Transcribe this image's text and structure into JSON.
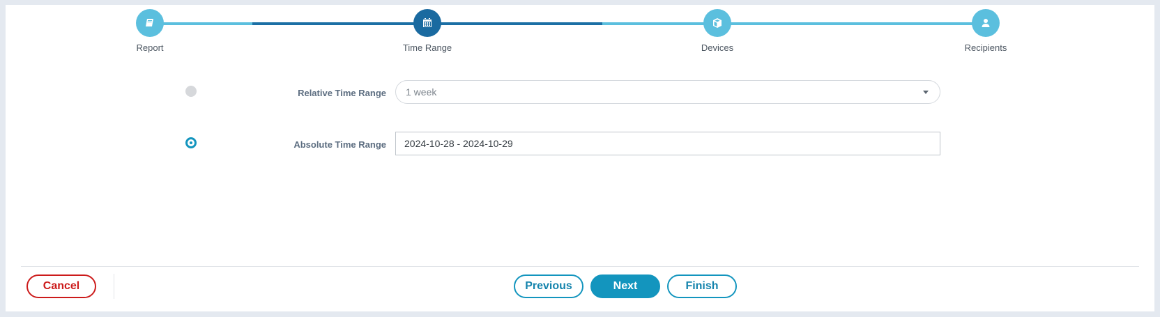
{
  "stepper": {
    "steps": [
      {
        "label": "Report",
        "icon": "book-icon"
      },
      {
        "label": "Time Range",
        "icon": "calendar-icon"
      },
      {
        "label": "Devices",
        "icon": "cube-icon"
      },
      {
        "label": "Recipients",
        "icon": "user-icon"
      }
    ],
    "active_step": "Time Range"
  },
  "form": {
    "relative": {
      "label": "Relative Time Range",
      "value": "1 week",
      "selected": false
    },
    "absolute": {
      "label": "Absolute Time Range",
      "value": "2024-10-28 - 2024-10-29",
      "selected": true
    }
  },
  "footer": {
    "cancel_label": "Cancel",
    "previous_label": "Previous",
    "next_label": "Next",
    "finish_label": "Finish"
  },
  "colors": {
    "primary": "#1395be",
    "active_step": "#1a6aa0",
    "inactive_step": "#5bbfde",
    "danger": "#cc1b1b"
  }
}
